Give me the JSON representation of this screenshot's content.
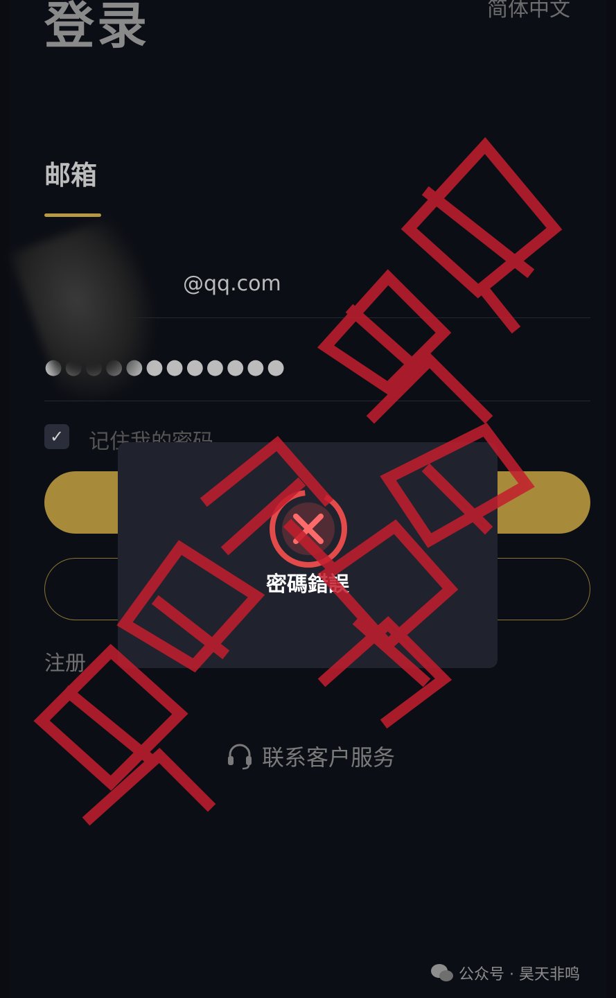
{
  "header": {
    "title": "登录",
    "language": "简体中文"
  },
  "tabs": {
    "email_label": "邮箱"
  },
  "form": {
    "email_value": "@qq.com",
    "password_value": "●●●●●●●●●●●●",
    "remember_label": "记住我的密码"
  },
  "register_label": "注册",
  "support_label": "联系客户服务",
  "toast": {
    "message": "密碼錯誤",
    "icon": "error-circle-icon"
  },
  "watermark": {
    "text": "昊天非鸣骗局"
  },
  "footer": {
    "text": "公众号 · 昊天非鸣"
  },
  "colors": {
    "accent": "#a88a3b",
    "watermark": "#c41e2e",
    "error": "#e34a4a"
  }
}
